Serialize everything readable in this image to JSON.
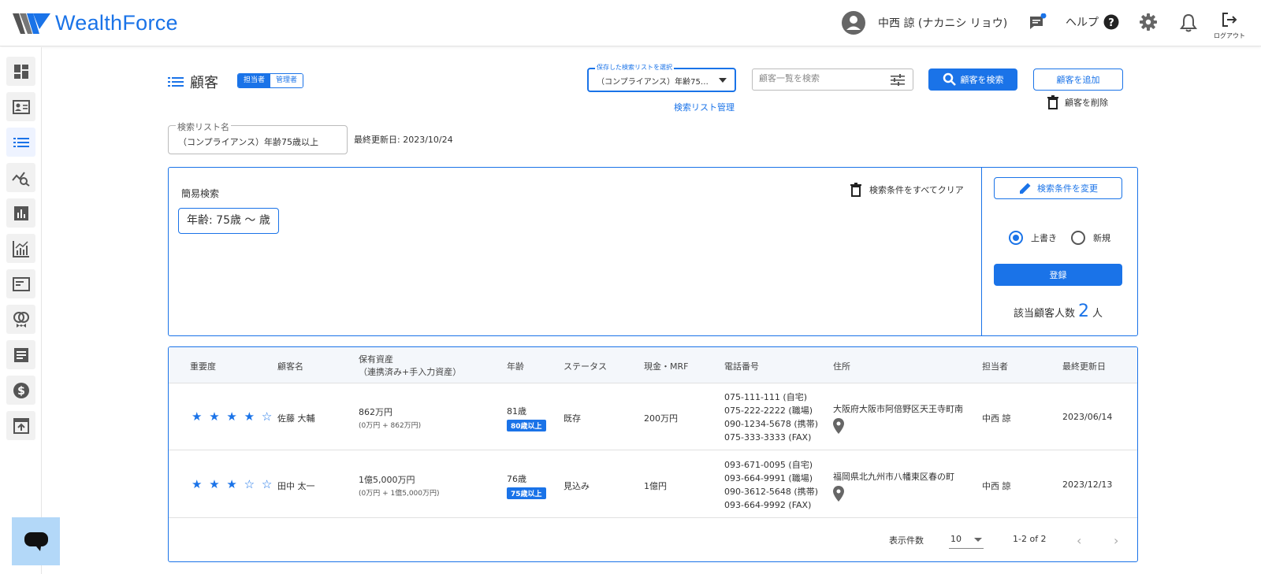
{
  "header": {
    "brand": "WealthForce",
    "user_name": "中西 諒 (ナカニシ リョウ)",
    "help_label": "ヘルプ",
    "logout_label": "ログアウト"
  },
  "page": {
    "title": "顧客",
    "role_tabs": [
      "担当者",
      "管理者"
    ]
  },
  "saved_list": {
    "label": "保存した検索リストを選択",
    "value": "（コンプライアンス）年齢75…",
    "manage_link": "検索リスト管理"
  },
  "search": {
    "placeholder": "顧客一覧を検索",
    "button": "顧客を検索"
  },
  "actions": {
    "add_customer": "顧客を追加",
    "delete_customer": "顧客を削除"
  },
  "list_name": {
    "label": "検索リスト名",
    "value": "（コンプライアンス）年齢75歳以上",
    "last_updated": "最終更新日: 2023/10/24"
  },
  "quick_search": {
    "title": "簡易検索",
    "clear_all": "検索条件をすべてクリア",
    "condition": "年齢: 75歳 〜 歳",
    "change_conditions": "検索条件を変更",
    "radio_overwrite": "上書き",
    "radio_new": "新規",
    "register": "登録",
    "count_label": "該当顧客人数",
    "count_value": "2",
    "count_unit": "人"
  },
  "table": {
    "headers": {
      "importance": "重要度",
      "name": "顧客名",
      "assets_1": "保有資産",
      "assets_2": "（連携済み+手入力資産）",
      "age": "年齢",
      "status": "ステータス",
      "cash": "現金・MRF",
      "phone": "電話番号",
      "address": "住所",
      "owner": "担当者",
      "updated": "最終更新日"
    },
    "rows": [
      {
        "stars": "★ ★ ★ ★ ☆",
        "name": "佐藤 大輔",
        "assets": "862万円",
        "assets_detail": "(0万円 + 862万円)",
        "age": "81歳",
        "age_badge": "80歳以上",
        "status": "既存",
        "cash": "200万円",
        "phones": [
          "075-111-111 (自宅)",
          "075-222-2222 (職場)",
          "090-1234-5678 (携帯)",
          "075-333-3333 (FAX)"
        ],
        "address": "大阪府大阪市阿倍野区天王寺町南",
        "owner": "中西 諒",
        "updated": "2023/06/14"
      },
      {
        "stars": "★ ★ ★ ☆ ☆",
        "name": "田中 太一",
        "assets": "1億5,000万円",
        "assets_detail": "(0万円 + 1億5,000万円)",
        "age": "76歳",
        "age_badge": "75歳以上",
        "status": "見込み",
        "cash": "1億円",
        "phones": [
          "093-671-0095 (自宅)",
          "093-664-9991 (職場)",
          "090-3612-5648 (携帯)",
          "093-664-9992 (FAX)"
        ],
        "address": "福岡県北九州市八幡東区春の町",
        "owner": "中西 諒",
        "updated": "2023/12/13"
      }
    ],
    "pagination": {
      "per_page_label": "表示件数",
      "per_page": "10",
      "range": "1-2 of 2"
    }
  },
  "colors": {
    "accent": "#1a73e8",
    "chat_fab": "#b3d8f8"
  }
}
